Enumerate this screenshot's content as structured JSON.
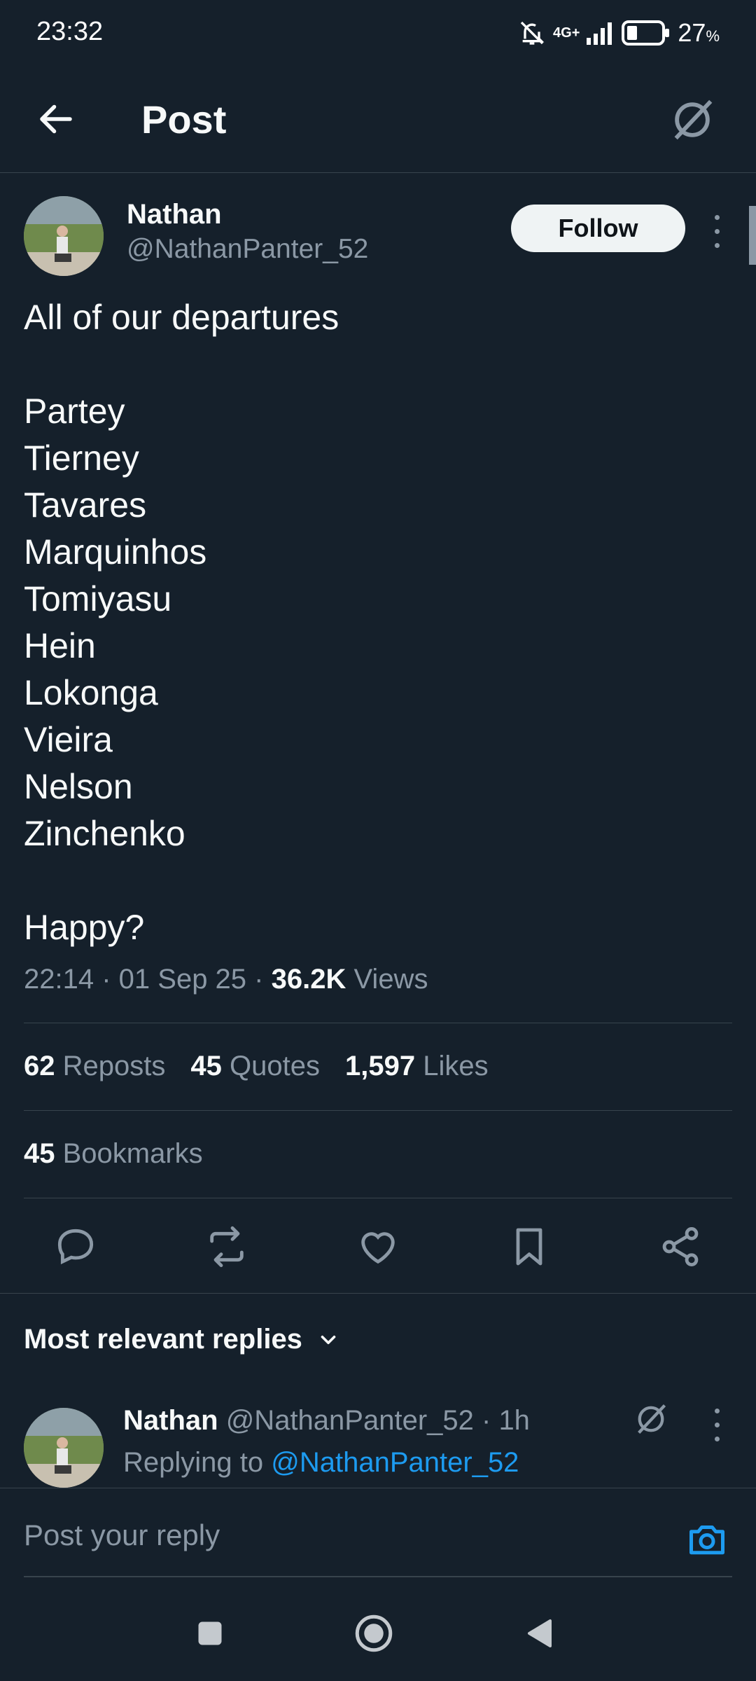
{
  "status_bar": {
    "time": "23:32",
    "network": "4G+",
    "battery": "27",
    "battery_unit": "%"
  },
  "header": {
    "title": "Post"
  },
  "author": {
    "name": "Nathan",
    "handle": "@NathanPanter_52",
    "follow_label": "Follow"
  },
  "post": {
    "lines": [
      "All of our departures",
      "",
      "Partey",
      "Tierney",
      "Tavares",
      "Marquinhos",
      "Tomiyasu",
      "Hein",
      "Lokonga",
      "Vieira",
      "Nelson",
      "Zinchenko",
      "",
      "Happy?"
    ],
    "time": "22:14",
    "date": "01 Sep 25",
    "views_count": "36.2K",
    "views_label": "Views"
  },
  "stats": {
    "reposts": {
      "count": "62",
      "label": "Reposts"
    },
    "quotes": {
      "count": "45",
      "label": "Quotes"
    },
    "likes": {
      "count": "1,597",
      "label": "Likes"
    },
    "bookmarks": {
      "count": "45",
      "label": "Bookmarks"
    }
  },
  "replies": {
    "sort_label": "Most relevant replies",
    "first_reply": {
      "name": "Nathan",
      "handle": "@NathanPanter_52",
      "time": "1h",
      "replying_prefix": "Replying to",
      "replying_to": "@NathanPanter_52"
    }
  },
  "composer": {
    "placeholder": "Post your reply"
  },
  "colors": {
    "background": "#15202b",
    "text": "#f7f9f9",
    "secondary": "#8b98a5",
    "accent": "#1d9bf0",
    "divider": "#38444d"
  }
}
